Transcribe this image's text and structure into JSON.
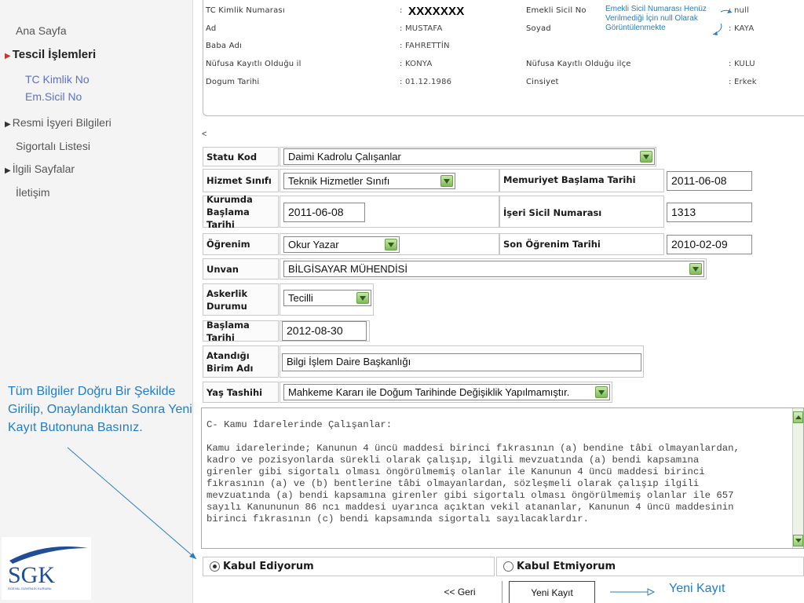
{
  "sidebar": {
    "items": [
      {
        "label": "Ana Sayfa"
      },
      {
        "label": "Tescil İşlemleri"
      },
      {
        "label": "TC Kimlik No"
      },
      {
        "label": "Em.Sicil No"
      },
      {
        "label": "Resmi İşyeri Bilgileri"
      },
      {
        "label": "Sigortalı Listesi"
      },
      {
        "label": "İlgili Sayfalar"
      },
      {
        "label": "İletişim"
      }
    ],
    "note": "Tüm Bilgiler Doğru Bir Şekilde Girilip, Onaylandıktan Sonra Yeni Kayıt Butonuna Basınız.",
    "logo_text": "SGK",
    "logo_subtext": "SOSYAL GÜVENLİK KURUMU"
  },
  "person": {
    "tc_label": "TC Kimlik Numarası",
    "tc_colon": ":",
    "tc_value": "XXXXXXX",
    "ad_label": "Ad",
    "ad_value": ": MUSTAFA",
    "baba_label": "Baba Adı",
    "baba_value": ": FAHRETTİN",
    "nufus_il_label": "Nüfusa Kayıtlı Olduğu il",
    "nufus_il_value": ": KONYA",
    "dogum_label": "Dogum Tarihi",
    "dogum_value": ": 01.12.1986",
    "emekli_label": "Emekli Sicil No",
    "emekli_value": ":  null",
    "soyad_label": "Soyad",
    "soyad_value": ":  KAYA",
    "nufus_ilce_label": "Nüfusa Kayıtlı Olduğu ilçe",
    "nufus_ilce_value": ":  KULU",
    "cinsiyet_label": "Cinsiyet",
    "cinsiyet_value": ":  Erkek",
    "annotation": "Emekli Sicil Numarası Henüz Verilmediği İçin null Olarak Görüntülenmekte"
  },
  "lt_symbol": "<",
  "form": {
    "statu_label": "Statu Kod",
    "statu_value": "Daimi Kadrolu Çalışanlar",
    "hizmet_label": "Hizmet Sınıfı",
    "hizmet_value": "Teknik Hizmetler Sınıfı",
    "memuriyet_label": "Memuriyet Başlama Tarihi",
    "memuriyet_value": "2011-06-08",
    "kurumda_label": "Kurumda Başlama Tarihi",
    "kurumda_value": "2011-06-08",
    "iseri_label": "İşeri Sicil Numarası",
    "iseri_value": "1313",
    "ogrenim_label": "Öğrenim",
    "ogrenim_value": "Okur Yazar",
    "son_ogrenim_label": "Son Öğrenim Tarihi",
    "son_ogrenim_value": "2010-02-09",
    "unvan_label": "Unvan",
    "unvan_value": "BİLGİSAYAR MÜHENDİSİ",
    "askerlik_label": "Askerlik Durumu",
    "askerlik_value": "Tecilli",
    "baslama_label": "Başlama Tarihi",
    "baslama_value": "2012-08-30",
    "birim_label": "Atandığı Birim Adı",
    "birim_value": "Bilgi İşlem Daire Başkanlığı",
    "yas_label": "Yaş Tashihi",
    "yas_value": "Mahkeme Kararı ile Doğum Tarihinde Değişiklik Yapılmamıştır."
  },
  "agreement": {
    "title": "C- Kamu İdarelerinde Çalışanlar:",
    "lines": [
      "Kamu idarelerinde; Kanunun 4 üncü maddesi birinci fıkrasının (a) bendine tâbi olmayanlardan,",
      "kadro ve pozisyonlarda sürekli olarak çalışıp, ilgili mevzuatında (a) bendi kapsamına",
      "girenler gibi sigortalı olması öngörülmemiş olanlar ile Kanunun 4 üncü maddesi birinci",
      "fıkrasının (a) ve (b) bentlerine tâbi olmayanlardan, sözleşmeli olarak çalışıp ilgili",
      "mevzuatında (a) bendi kapsamına girenler gibi sigortalı olması öngörülmemiş olanlar ile 657",
      "sayılı Kanununun 86 ncı maddesi uyarınca açıktan vekil atananlar, Kanunun 4 üncü maddesinin",
      "birinci fıkrasının (c) bendi kapsamında  sigortalı sayılacaklardır."
    ]
  },
  "radios": {
    "accept": "Kabul Ediyorum",
    "reject": "Kabul Etmiyorum",
    "accept_selected": true
  },
  "buttons": {
    "back": "<< Geri",
    "new": "Yeni Kayıt"
  },
  "yeni_kayit_note": "Yeni Kayıt",
  "colors": {
    "accent_blue": "#1f7ec8",
    "sub_link": "#5a72c9",
    "logo_blue": "#1f4e96",
    "dropdown_green": "#7fba5a",
    "active_marker": "#c0392b"
  }
}
